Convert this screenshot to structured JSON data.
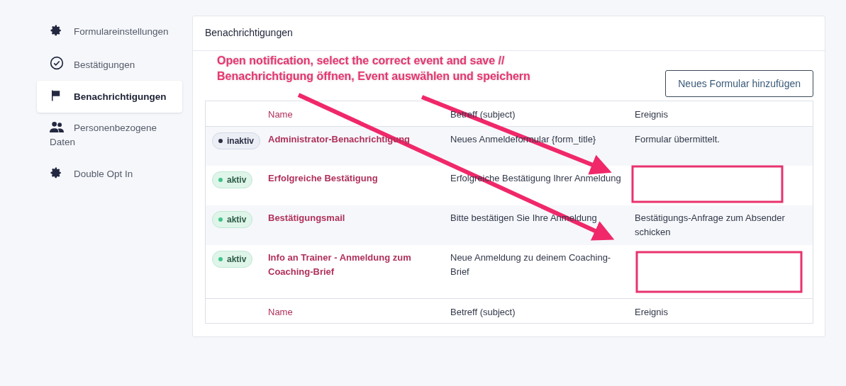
{
  "sidebar": {
    "items": [
      {
        "label": "Formulareinstellungen",
        "selected": false
      },
      {
        "label": "Bestätigungen",
        "selected": false
      },
      {
        "label": "Benachrichtigungen",
        "selected": true
      },
      {
        "label": "Personenbezogene Daten",
        "selected": false
      },
      {
        "label": "Double Opt In",
        "selected": false
      }
    ]
  },
  "panel": {
    "title": "Benachrichtigungen",
    "annotation": [
      "Open notification, select the correct event and save //",
      "Benachrichtigung öffnen, Event auswählen und speichern"
    ],
    "add_button": "Neues Formular hinzufügen",
    "table": {
      "columns": [
        "Name",
        "Betreff (subject)",
        "Ereignis"
      ],
      "rows": [
        {
          "status": "inaktiv",
          "active": false,
          "name": "Administrator-Benachrichtigung",
          "subject": "Neues Anmeldeformular {form_title}",
          "event": "Formular übermittelt."
        },
        {
          "status": "aktiv",
          "active": true,
          "name": "Erfolgreiche Bestätigung",
          "subject": "Erfolgreiche Bestätigung Ihrer Anmeldung"
        },
        {
          "status": "aktiv",
          "active": true,
          "name": "Bestätigungsmail",
          "subject": "Bitte bestätigen Sie Ihre Anmeldung",
          "event": "Bestätigungs-Anfrage zum Absender schicken"
        },
        {
          "status": "aktiv",
          "active": true,
          "name": "Info an Trainer - Anmeldung zum Coaching-Brief",
          "subject": "Neue Anmeldung zu deinem Coaching-Brief"
        }
      ],
      "footer": [
        "Name",
        "Betreff (subject)",
        "Ereignis"
      ]
    }
  }
}
